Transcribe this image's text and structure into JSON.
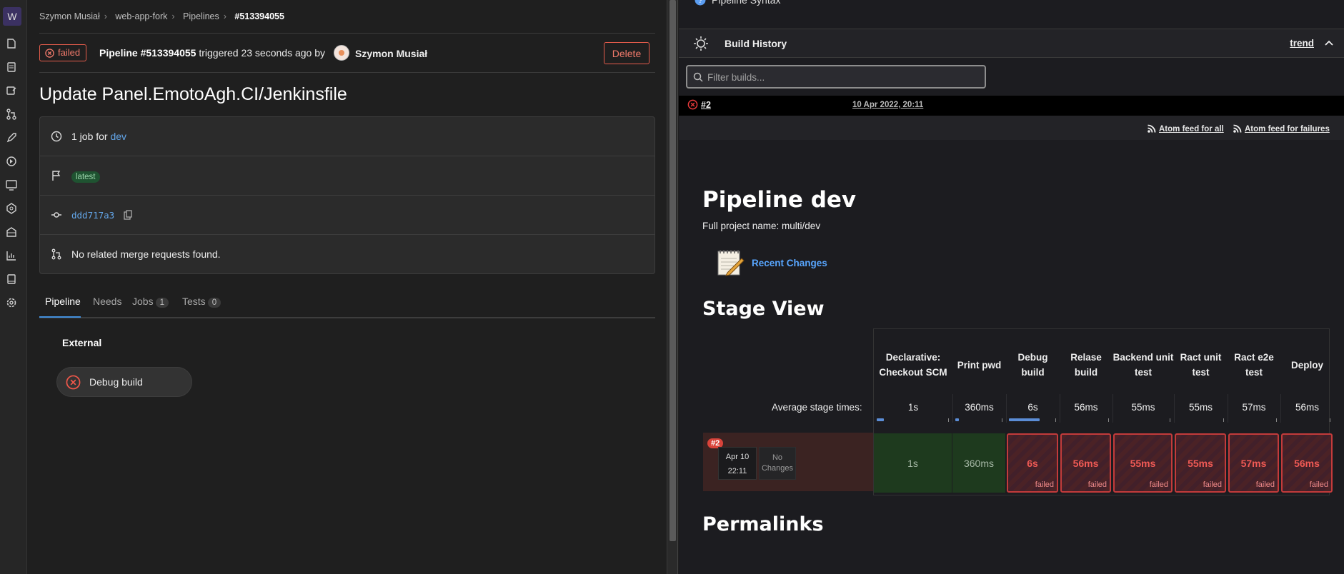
{
  "gitlab": {
    "breadcrumbs": [
      "Szymon Musiał",
      "web-app-fork",
      "Pipelines",
      "#513394055"
    ],
    "status_label": "failed",
    "pipeline_label": "Pipeline #513394055",
    "triggered_text": "triggered 23 seconds ago by",
    "user_name": "Szymon Musiał",
    "delete_label": "Delete",
    "commit_title": "Update Panel.EmotoAgh.CI/Jenkinsfile",
    "jobs_prefix": "1 job for",
    "branch": "dev",
    "latest_badge": "latest",
    "commit_sha": "ddd717a3",
    "merge_requests_text": "No related merge requests found.",
    "tabs": [
      {
        "label": "Pipeline",
        "count": ""
      },
      {
        "label": "Needs",
        "count": ""
      },
      {
        "label": "Jobs",
        "count": "1"
      },
      {
        "label": "Tests",
        "count": "0"
      }
    ],
    "stage_group": "External",
    "job_name": "Debug build",
    "rail_logo": "W",
    "rail_icons": [
      "project-icon",
      "issues-icon",
      "merge-request-icon",
      "merge-branch-icon",
      "rocket-icon",
      "ci-icon",
      "monitor-icon",
      "cloud-icon",
      "package-icon",
      "analytics-icon",
      "wiki-icon",
      "settings-icon"
    ]
  },
  "jenkins": {
    "pipeline_syntax": "Pipeline Syntax",
    "build_history": "Build History",
    "trend": "trend",
    "filter_placeholder": "Filter builds...",
    "build_number": "#2",
    "build_date": "10 Apr 2022, 20:11",
    "feed_all": "Atom feed for all",
    "feed_failures": "Atom feed for failures",
    "title": "Pipeline dev",
    "full_name": "Full project name: multi/dev",
    "recent_changes": "Recent Changes",
    "stage_view": "Stage View",
    "avg_label": "Average stage times:",
    "stages": [
      {
        "name": "Declarative: Checkout SCM",
        "avg": "1s",
        "bar": 0.02,
        "run": "1s",
        "status": "success"
      },
      {
        "name": "Print pwd",
        "avg": "360ms",
        "bar": 0.01,
        "run": "360ms",
        "status": "success"
      },
      {
        "name": "Debug build",
        "avg": "6s",
        "bar": 0.09,
        "run": "6s",
        "status": "failed"
      },
      {
        "name": "Relase build",
        "avg": "56ms",
        "bar": 0.0,
        "run": "56ms",
        "status": "failed"
      },
      {
        "name": "Backend unit test",
        "avg": "55ms",
        "bar": 0.0,
        "run": "55ms",
        "status": "failed"
      },
      {
        "name": "Ract unit test",
        "avg": "55ms",
        "bar": 0.0,
        "run": "55ms",
        "status": "failed"
      },
      {
        "name": "Ract e2e test",
        "avg": "57ms",
        "bar": 0.0,
        "run": "57ms",
        "status": "failed"
      },
      {
        "name": "Deploy",
        "avg": "56ms",
        "bar": 0.0,
        "run": "56ms",
        "status": "failed"
      }
    ],
    "failed_label": "failed",
    "run_badge": "#2",
    "run_date": "Apr 10",
    "run_time": "22:11",
    "no_changes": "No Changes",
    "permalinks": "Permalinks"
  }
}
